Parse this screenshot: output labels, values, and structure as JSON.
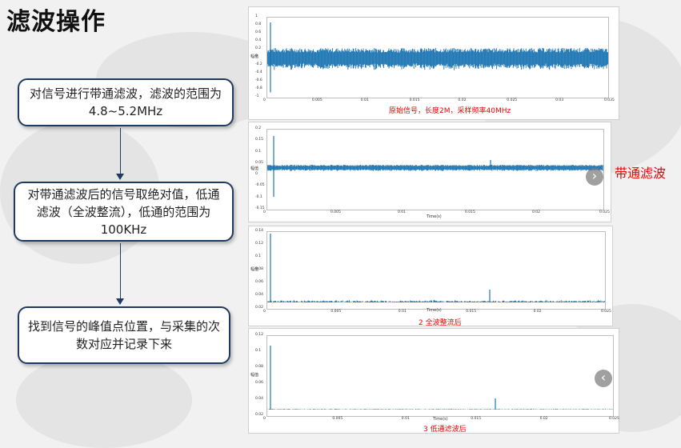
{
  "slide": {
    "title": "滤波操作",
    "steps": [
      {
        "text": "对信号进行带通滤波，滤波的范围为4.8~5.2MHz"
      },
      {
        "text": "对带通滤波后的信号取绝对值，低通滤波（全波整流），低通的范围为100KHz"
      },
      {
        "text": "找到信号的峰值点位置，与采集的次数对应并记录下来"
      }
    ],
    "side_label": "带通滤波",
    "nav": {
      "next_icon": "chevron-right-icon"
    },
    "panels": [
      {
        "caption": "原始信号，长度2M，采样频率40MHz",
        "ylabel": "幅值",
        "xlabel": "",
        "yticks": [
          "1",
          "0.8",
          "0.6",
          "0.4",
          "0.2",
          "0",
          "-0.2",
          "-0.4",
          "-0.6",
          "-0.8",
          "-1"
        ],
        "xticks": [
          "0",
          "0.005",
          "0.01",
          "0.015",
          "0.02",
          "0.025",
          "0.03",
          "0.035"
        ]
      },
      {
        "caption": "",
        "ylabel": "幅值",
        "xlabel": "Time(s)",
        "yticks": [
          "0.2",
          "0.15",
          "0.1",
          "0.05",
          "0",
          "-0.05",
          "-0.1",
          "-0.15"
        ],
        "xticks": [
          "0",
          "0.005",
          "0.01",
          "0.015",
          "0.02",
          "0.025"
        ]
      },
      {
        "caption": "2 全波整流后",
        "ylabel": "幅值",
        "xlabel": "Time(s)",
        "yticks": [
          "0.14",
          "0.12",
          "0.1",
          "0.08",
          "0.06",
          "0.04",
          "0.02"
        ],
        "xticks": [
          "0",
          "0.005",
          "0.01",
          "0.015",
          "0.02",
          "0.025"
        ]
      },
      {
        "caption": "3 低通滤波后",
        "ylabel": "幅值",
        "xlabel": "Time(s)",
        "yticks": [
          "0.12",
          "0.1",
          "0.08",
          "0.06",
          "0.04",
          "0.02"
        ],
        "xticks": [
          "0",
          "0.005",
          "0.01",
          "0.015",
          "0.02",
          "0.025"
        ]
      }
    ]
  },
  "colors": {
    "signal": "#1f77b4",
    "accent_red": "#e00000",
    "box_border": "#1f3a5f"
  }
}
